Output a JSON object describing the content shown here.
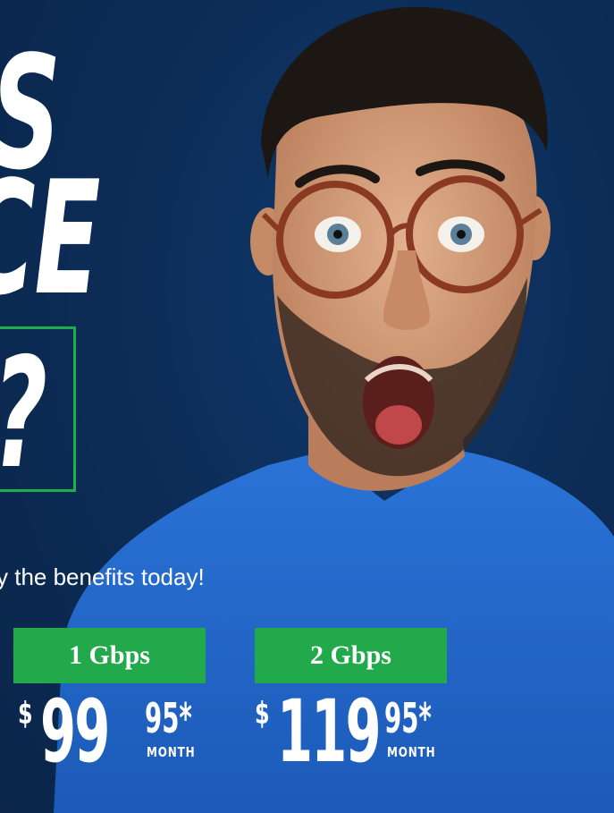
{
  "headline": {
    "line1": "S",
    "line2": "CE",
    "line3": "?"
  },
  "tagline": "y the benefits today!",
  "plans": [
    {
      "speed": "1 Gbps",
      "currency": "$",
      "price_main": "99",
      "price_cents": "95*",
      "unit": "MONTH"
    },
    {
      "speed": "2 Gbps",
      "currency": "$",
      "price_main": "119",
      "price_cents": "95*",
      "unit": "MONTH"
    }
  ],
  "colors": {
    "background": "#0b2a50",
    "accent_green": "#22a94b",
    "shirt_blue": "#1f63c6",
    "text": "#ffffff"
  },
  "image_subject": "surprised-man-with-glasses"
}
